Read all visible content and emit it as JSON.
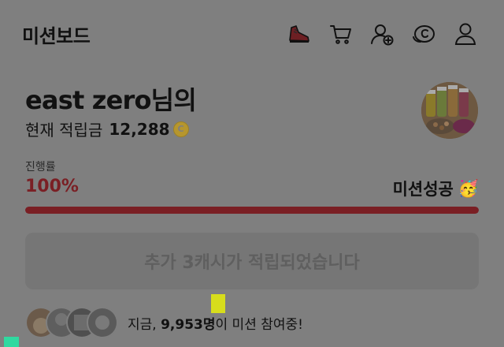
{
  "header": {
    "title": "미션보드",
    "icons": [
      "sneaker-icon",
      "cart-icon",
      "user-add-icon",
      "coin-icon",
      "profile-icon"
    ]
  },
  "user": {
    "name": "east zero님의",
    "balance_label": "현재 적립금",
    "balance_value": "12,288",
    "coin_symbol": "C"
  },
  "progress": {
    "label": "진행률",
    "percent_text": "100%",
    "fraction": 1.0,
    "status": "미션성공",
    "status_emoji": "🥳"
  },
  "reward": {
    "button_label": "추가 3캐시가 적립되었습니다"
  },
  "participants": {
    "prefix": "지금,",
    "count": "9,953명",
    "suffix": "이 미션 참여중!"
  },
  "colors": {
    "background": "#7f7f7f",
    "accent": "#7a1f24",
    "coin": "#b6962e"
  }
}
